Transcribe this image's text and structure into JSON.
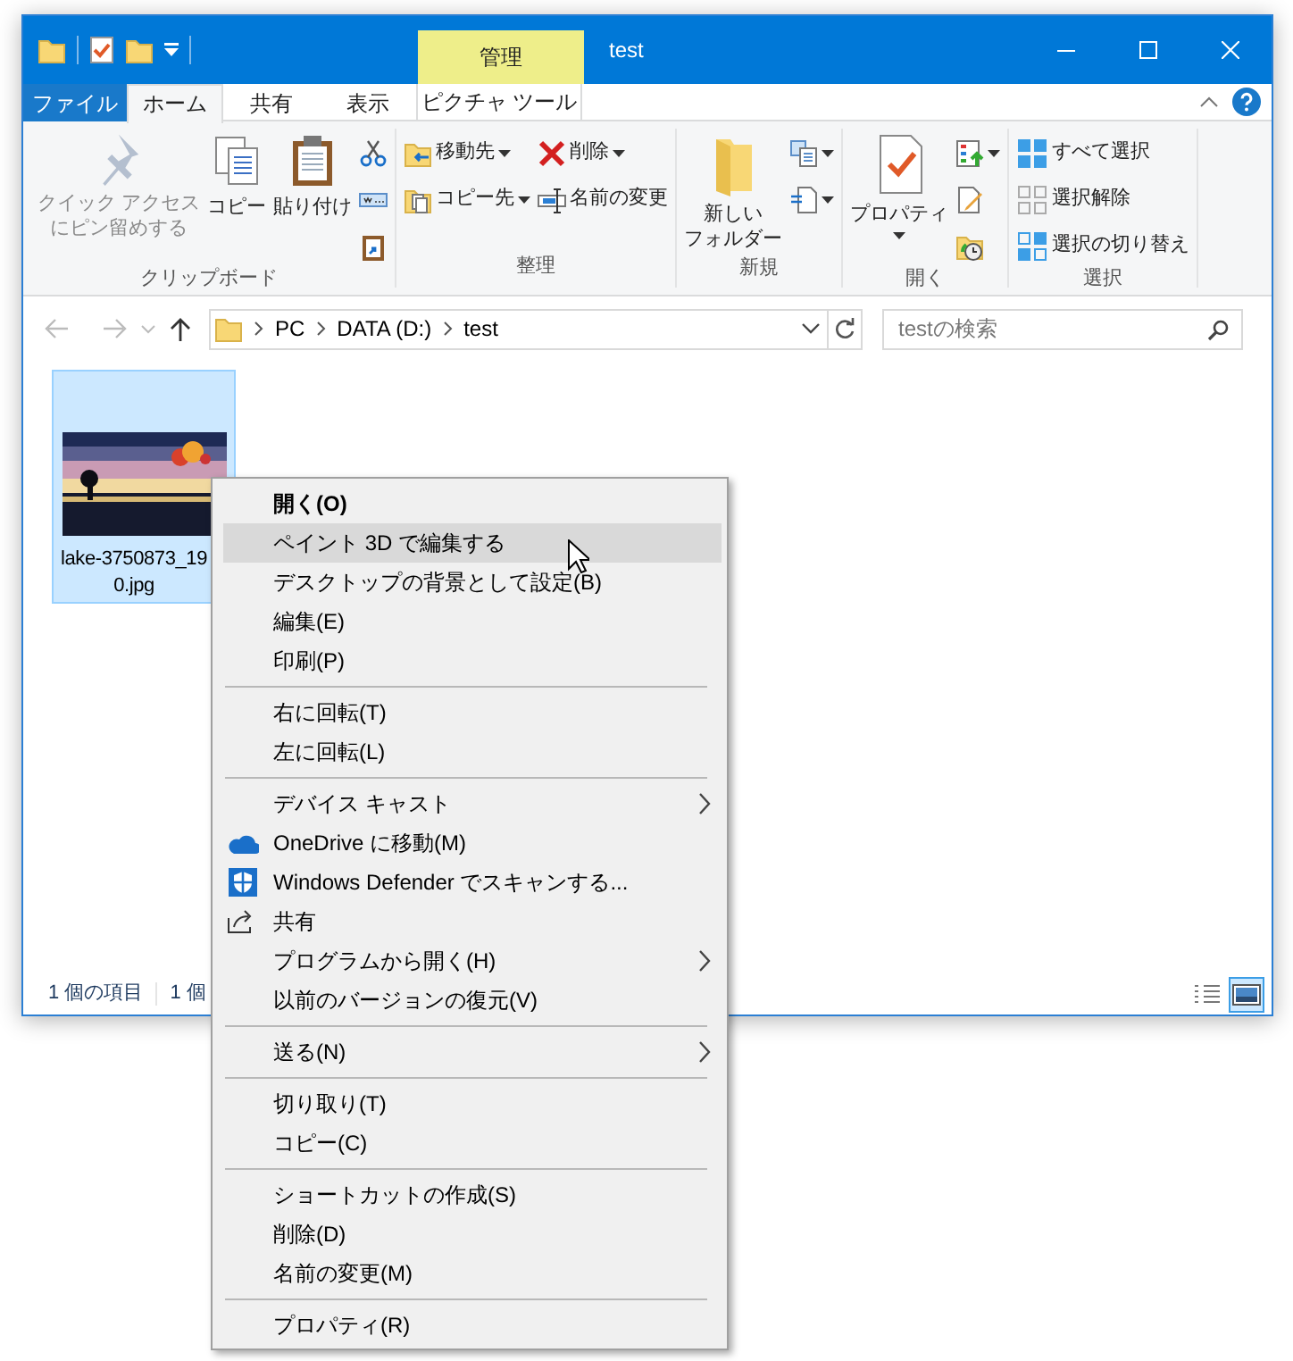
{
  "window": {
    "title": "test",
    "context_tab": "管理"
  },
  "ribbon_tabs": [
    {
      "label": "ファイル",
      "kind": "file",
      "selected": false
    },
    {
      "label": "ホーム",
      "kind": "tab",
      "selected": true
    },
    {
      "label": "共有",
      "kind": "tab",
      "selected": false
    },
    {
      "label": "表示",
      "kind": "tab",
      "selected": false
    },
    {
      "label": "ピクチャ ツール",
      "kind": "context",
      "selected": false
    }
  ],
  "ribbon": {
    "groups": [
      {
        "label": "クリップボード",
        "items": [
          {
            "kind": "large",
            "lines": [
              "クイック アクセス",
              "にピン留めする"
            ],
            "disabled": true,
            "dropdown": false
          },
          {
            "kind": "large",
            "lines": [
              "コピー"
            ],
            "disabled": false,
            "dropdown": false
          },
          {
            "kind": "large",
            "lines": [
              "貼り付け"
            ],
            "disabled": false,
            "dropdown": false
          },
          {
            "kind": "stack",
            "items": [
              {
                "kind": "icon",
                "dropdown": false
              },
              {
                "kind": "icon",
                "dropdown": false
              },
              {
                "kind": "icon",
                "dropdown": false
              }
            ]
          }
        ]
      },
      {
        "label": "整理",
        "items": [
          {
            "kind": "stack",
            "items": [
              {
                "kind": "small",
                "label": "移動先",
                "dropdown": true
              },
              {
                "kind": "small",
                "label": "コピー先",
                "dropdown": true
              }
            ]
          },
          {
            "kind": "stack",
            "items": [
              {
                "kind": "small",
                "label": "削除",
                "dropdown": true
              },
              {
                "kind": "small",
                "label": "名前の変更",
                "dropdown": false
              }
            ]
          }
        ]
      },
      {
        "label": "新規",
        "items": [
          {
            "kind": "large",
            "lines": [
              "新しい",
              "フォルダー"
            ],
            "disabled": false,
            "dropdown": false
          },
          {
            "kind": "stack",
            "items": [
              {
                "kind": "icon",
                "dropdown": true
              },
              {
                "kind": "icon",
                "dropdown": true
              }
            ]
          }
        ]
      },
      {
        "label": "開く",
        "items": [
          {
            "kind": "large",
            "lines": [
              "プロパティ"
            ],
            "disabled": false,
            "dropdown": true
          },
          {
            "kind": "stack",
            "items": [
              {
                "kind": "icon",
                "dropdown": true
              },
              {
                "kind": "icon",
                "dropdown": false
              },
              {
                "kind": "icon",
                "dropdown": false
              }
            ]
          }
        ]
      },
      {
        "label": "選択",
        "items": [
          {
            "kind": "stack",
            "items": [
              {
                "kind": "small",
                "label": "すべて選択",
                "dropdown": false
              },
              {
                "kind": "small",
                "label": "選択解除",
                "dropdown": false
              },
              {
                "kind": "small",
                "label": "選択の切り替え",
                "dropdown": false
              }
            ]
          }
        ]
      }
    ]
  },
  "address": {
    "path": [
      "PC",
      "DATA (D:)",
      "test"
    ]
  },
  "search": {
    "placeholder": "testの検索"
  },
  "files": [
    {
      "lines": [
        "lake-3750873_19",
        "0.jpg"
      ],
      "selected": true
    }
  ],
  "status_bar": {
    "texts": [
      "1 個の項目",
      "1 個"
    ],
    "views": [
      {
        "kind": "details",
        "selected": false
      },
      {
        "kind": "large_icons",
        "selected": true
      }
    ]
  },
  "context_menu": [
    {
      "kind": "item",
      "label": "開く(O)",
      "default": true,
      "selected": false,
      "submenu": false
    },
    {
      "kind": "item",
      "label": "ペイント 3D で編集する",
      "default": false,
      "selected": true,
      "submenu": false
    },
    {
      "kind": "item",
      "label": "デスクトップの背景として設定(B)",
      "default": false,
      "selected": false,
      "submenu": false
    },
    {
      "kind": "item",
      "label": "編集(E)",
      "default": false,
      "selected": false,
      "submenu": false
    },
    {
      "kind": "item",
      "label": "印刷(P)",
      "default": false,
      "selected": false,
      "submenu": false
    },
    {
      "kind": "separator"
    },
    {
      "kind": "item",
      "label": "右に回転(T)",
      "default": false,
      "selected": false,
      "submenu": false
    },
    {
      "kind": "item",
      "label": "左に回転(L)",
      "default": false,
      "selected": false,
      "submenu": false
    },
    {
      "kind": "separator"
    },
    {
      "kind": "item",
      "label": "デバイス キャスト",
      "default": false,
      "selected": false,
      "submenu": true
    },
    {
      "kind": "item",
      "label": "OneDrive に移動(M)",
      "default": false,
      "selected": false,
      "submenu": false,
      "icon": true
    },
    {
      "kind": "item",
      "label": "Windows Defender でスキャンする...",
      "default": false,
      "selected": false,
      "submenu": false,
      "icon": true
    },
    {
      "kind": "item",
      "label": "共有",
      "default": false,
      "selected": false,
      "submenu": false,
      "icon": true
    },
    {
      "kind": "item",
      "label": "プログラムから開く(H)",
      "default": false,
      "selected": false,
      "submenu": true
    },
    {
      "kind": "item",
      "label": "以前のバージョンの復元(V)",
      "default": false,
      "selected": false,
      "submenu": false
    },
    {
      "kind": "separator"
    },
    {
      "kind": "item",
      "label": "送る(N)",
      "default": false,
      "selected": false,
      "submenu": true
    },
    {
      "kind": "separator"
    },
    {
      "kind": "item",
      "label": "切り取り(T)",
      "default": false,
      "selected": false,
      "submenu": false
    },
    {
      "kind": "item",
      "label": "コピー(C)",
      "default": false,
      "selected": false,
      "submenu": false
    },
    {
      "kind": "separator"
    },
    {
      "kind": "item",
      "label": "ショートカットの作成(S)",
      "default": false,
      "selected": false,
      "submenu": false
    },
    {
      "kind": "item",
      "label": "削除(D)",
      "default": false,
      "selected": false,
      "submenu": false
    },
    {
      "kind": "item",
      "label": "名前の変更(M)",
      "default": false,
      "selected": false,
      "submenu": false
    },
    {
      "kind": "separator"
    },
    {
      "kind": "item",
      "label": "プロパティ(R)",
      "default": false,
      "selected": false,
      "submenu": false
    }
  ]
}
